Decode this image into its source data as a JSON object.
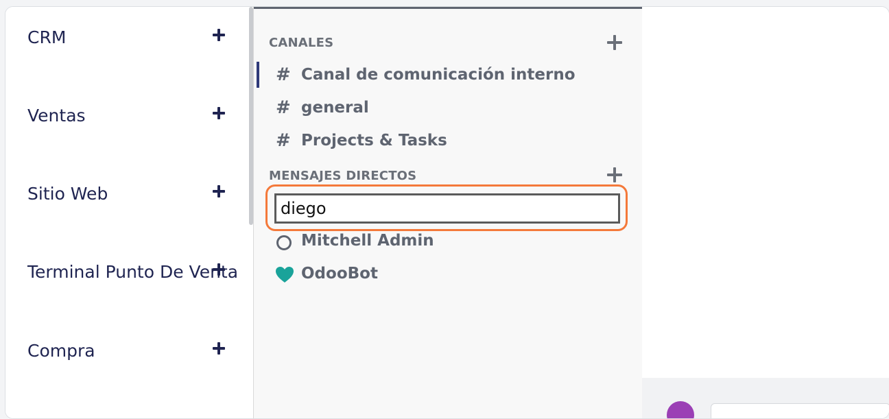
{
  "apps": {
    "items": [
      {
        "label": "CRM"
      },
      {
        "label": "Ventas"
      },
      {
        "label": "Sitio Web"
      },
      {
        "label": "Terminal Punto De Venta"
      },
      {
        "label": "Compra"
      }
    ]
  },
  "discuss": {
    "channels_title": "CANALES",
    "channels": [
      {
        "name": "Canal de comunicación interno",
        "active": true
      },
      {
        "name": "general",
        "active": false
      },
      {
        "name": "Projects & Tasks",
        "active": false
      }
    ],
    "dm_title": "MENSAJES DIRECTOS",
    "dm_search": {
      "value": "diego"
    },
    "dms": [
      {
        "name": "Mitchell Admin",
        "status_icon": "offline-circle-icon"
      },
      {
        "name": "OdooBot",
        "status_icon": "heart-icon"
      }
    ]
  },
  "colors": {
    "app_text": "#1f2451",
    "sidebar_text": "#5e6470",
    "highlight": "#f4793a",
    "active_bar": "#2f3a7a",
    "odoobot_heart": "#1aa39a"
  }
}
